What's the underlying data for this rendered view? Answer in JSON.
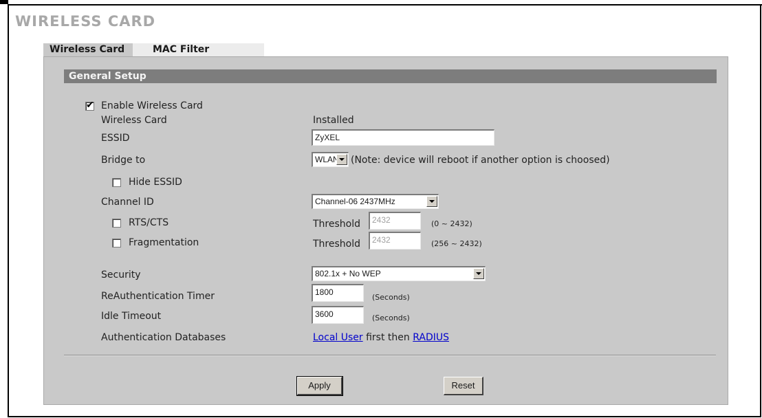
{
  "title": "WIRELESS CARD",
  "tabs": [
    {
      "label": "Wireless Card",
      "active": true
    },
    {
      "label": "MAC Filter",
      "active": false
    }
  ],
  "section": {
    "title": "General Setup"
  },
  "form": {
    "enable_wireless": {
      "label": "Enable Wireless Card",
      "checked": true
    },
    "wireless_card": {
      "label": "Wireless Card",
      "value": "Installed"
    },
    "essid": {
      "label": "ESSID",
      "value": "ZyXEL"
    },
    "bridge_to": {
      "label": "Bridge to",
      "value": "WLAN",
      "note": "(Note: device will reboot if another option is choosed)"
    },
    "hide_essid": {
      "label": "Hide ESSID",
      "checked": false
    },
    "channel_id": {
      "label": "Channel ID",
      "value": "Channel-06 2437MHz"
    },
    "rts_cts": {
      "label": "RTS/CTS",
      "checked": false,
      "threshold_label": "Threshold",
      "threshold_value": "2432",
      "range": "(0 ~ 2432)"
    },
    "fragmentation": {
      "label": "Fragmentation",
      "checked": false,
      "threshold_label": "Threshold",
      "threshold_value": "2432",
      "range": "(256 ~ 2432)"
    },
    "security": {
      "label": "Security",
      "value": "802.1x + No WEP"
    },
    "reauth_timer": {
      "label": "ReAuthentication Timer",
      "value": "1800",
      "unit": "(Seconds)"
    },
    "idle_timeout": {
      "label": "Idle Timeout",
      "value": "3600",
      "unit": "(Seconds)"
    },
    "auth_db": {
      "label": "Authentication Databases",
      "link1": "Local User",
      "middle": " first then ",
      "link2": "RADIUS"
    }
  },
  "buttons": {
    "apply": "Apply",
    "reset": "Reset"
  }
}
